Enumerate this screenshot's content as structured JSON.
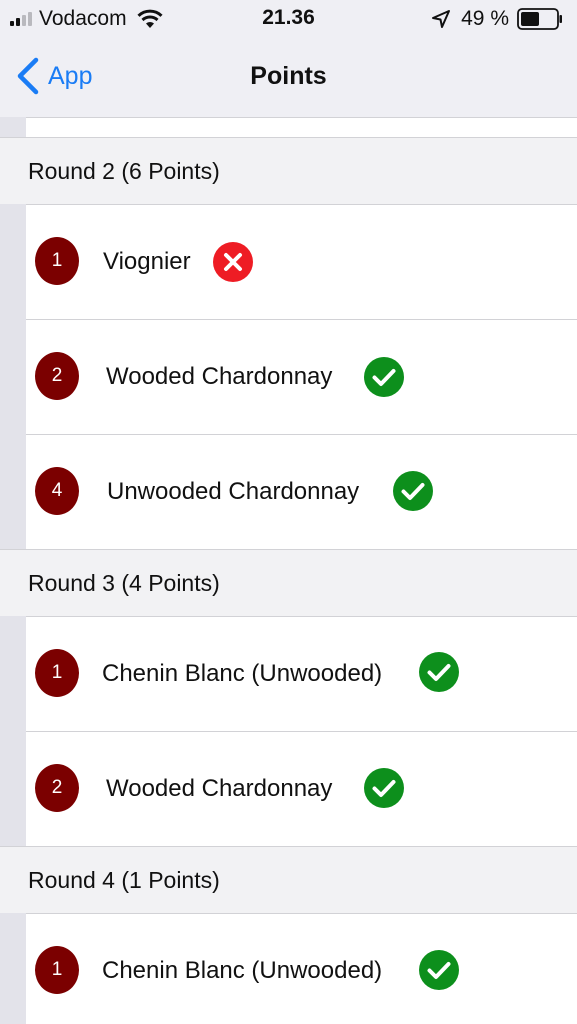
{
  "status_bar": {
    "carrier": "Vodacom",
    "time": "21.36",
    "battery": "49 %"
  },
  "nav": {
    "back_label": "App",
    "title": "Points"
  },
  "sections": [
    {
      "title": "Round 2 (6 Points)",
      "items": [
        {
          "rank": "1",
          "name": "Viognier",
          "status": "incorrect"
        },
        {
          "rank": "2",
          "name": "Wooded Chardonnay",
          "status": "correct"
        },
        {
          "rank": "4",
          "name": "Unwooded Chardonnay",
          "status": "correct"
        }
      ]
    },
    {
      "title": "Round 3 (4 Points)",
      "items": [
        {
          "rank": "1",
          "name": "Chenin Blanc (Unwooded)",
          "status": "correct"
        },
        {
          "rank": "2",
          "name": "Wooded Chardonnay",
          "status": "correct"
        }
      ]
    },
    {
      "title": "Round 4 (1 Points)",
      "items": [
        {
          "rank": "1",
          "name": "Chenin Blanc (Unwooded)",
          "status": "correct"
        }
      ]
    }
  ],
  "colors": {
    "accent": "#1a7cf5",
    "badge": "#7b0000",
    "correct": "#0d8f1c",
    "incorrect": "#ee1c24"
  },
  "icons": {
    "correct": "checkmark-circle-icon",
    "incorrect": "cross-circle-icon"
  }
}
